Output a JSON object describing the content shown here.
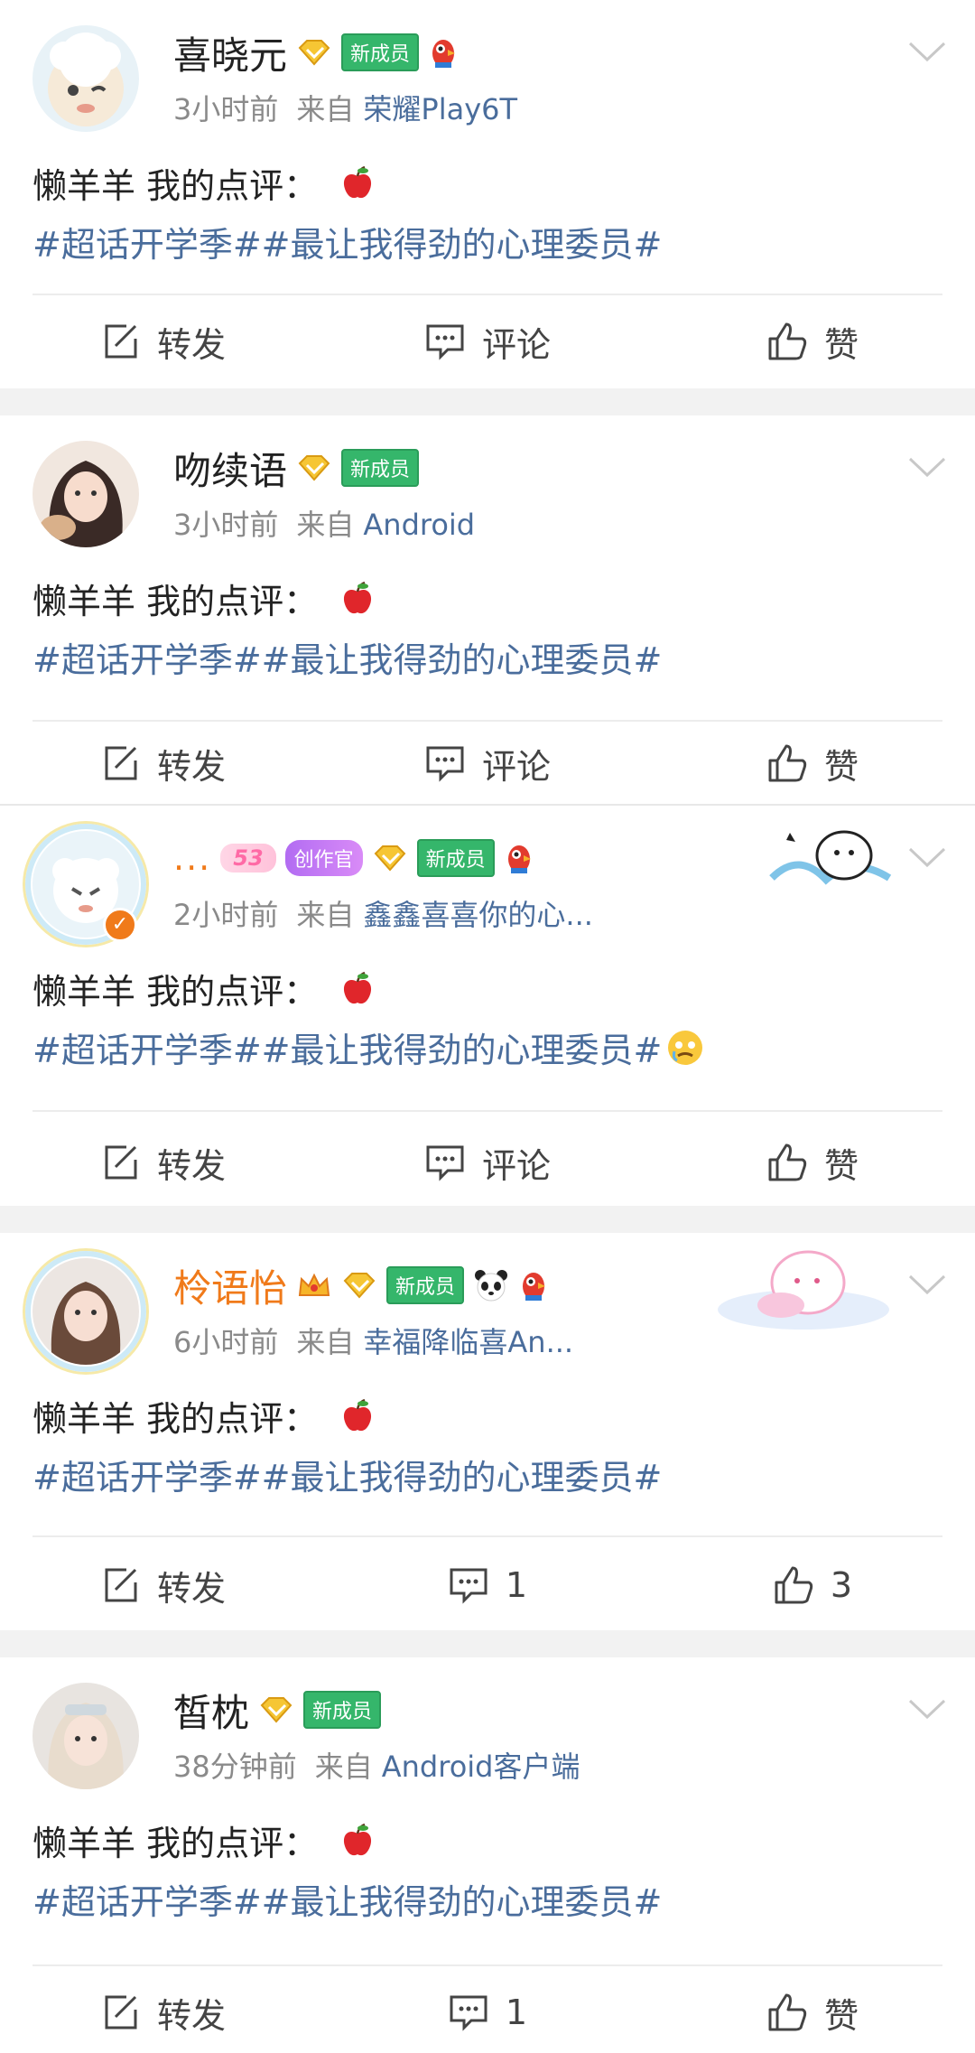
{
  "posts": [
    {
      "username": "喜晓元",
      "time": "3小时前",
      "from_label": "来自",
      "source": "荣耀Play6T",
      "line1": "懒羊羊 我的点评：",
      "line2": "#超话开学季##最让我得劲的心理委员#",
      "new_badge": "新成员",
      "actions": {
        "repost": "转发",
        "comment": "评论",
        "like": "赞"
      }
    },
    {
      "username": "吻续语",
      "time": "3小时前",
      "from_label": "来自",
      "source": "Android",
      "line1": "懒羊羊 我的点评：",
      "line2": "#超话开学季##最让我得劲的心理委员#",
      "new_badge": "新成员",
      "actions": {
        "repost": "转发",
        "comment": "评论",
        "like": "赞"
      }
    },
    {
      "username": "...",
      "time": "2小时前",
      "from_label": "来自",
      "source": "鑫鑫喜喜你的心...",
      "line1": "懒羊羊 我的点评：",
      "line2": "#超话开学季##最让我得劲的心理委员#",
      "new_badge": "新成员",
      "creator_badge": "创作官",
      "pink_badge": "53",
      "actions": {
        "repost": "转发",
        "comment": "评论",
        "like": "赞"
      }
    },
    {
      "username": "柃语怡",
      "time": "6小时前",
      "from_label": "来自",
      "source": "幸福降临喜An...",
      "line1": "懒羊羊 我的点评：",
      "line2": "#超话开学季##最让我得劲的心理委员#",
      "new_badge": "新成员",
      "actions": {
        "repost": "转发",
        "comment": "1",
        "like": "3"
      }
    },
    {
      "username": "皙枕",
      "time": "38分钟前",
      "from_label": "来自",
      "source": "Android客户端",
      "line1": "懒羊羊 我的点评：",
      "line2": "#超话开学季##最让我得劲的心理委员#",
      "new_badge": "新成员",
      "actions": {
        "repost": "转发",
        "comment": "1",
        "like": "赞"
      }
    }
  ],
  "colors": {
    "link": "#4a6d9c",
    "new_badge": "#35b66b",
    "vip_name": "#f07a1a",
    "separator": "#f2f2f2"
  }
}
